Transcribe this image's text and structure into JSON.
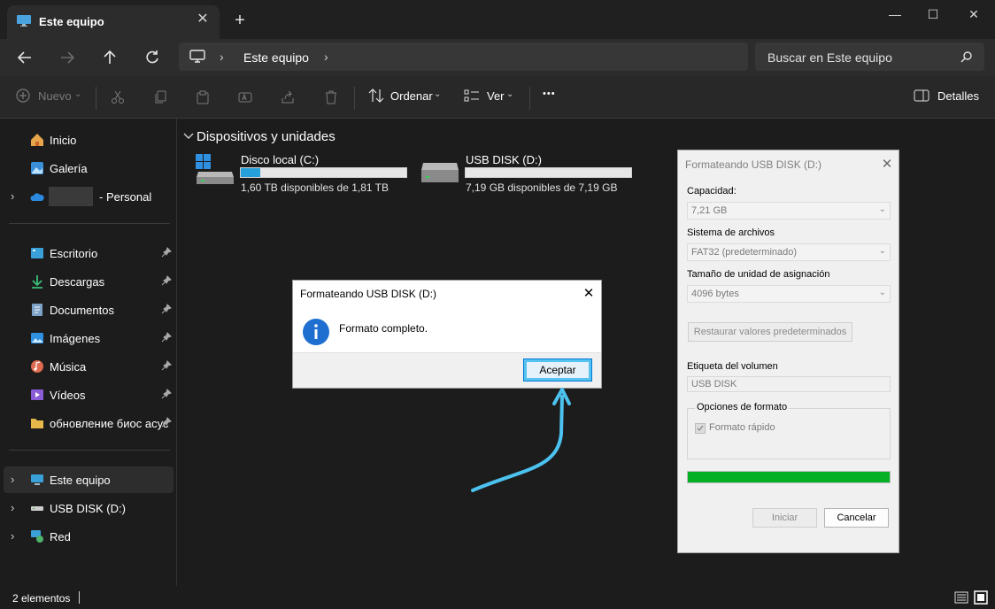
{
  "window": {
    "tab_title": "Este equipo",
    "tab_close": "✕",
    "new_tab": "+",
    "minimize": "—",
    "maximize": "☐",
    "close": "✕"
  },
  "nav": {
    "breadcrumb_current": "Este equipo",
    "breadcrumb_separator": "›",
    "search_placeholder": "Buscar en Este equipo"
  },
  "toolbar": {
    "new_label": "Nuevo",
    "sort_label": "Ordenar",
    "view_label": "Ver",
    "more_label": "•••",
    "details_label": "Detalles"
  },
  "sidebar": {
    "items": [
      {
        "label": "Inicio"
      },
      {
        "label": "Galería"
      },
      {
        "label": "- Personal"
      },
      {
        "label": "Escritorio"
      },
      {
        "label": "Descargas"
      },
      {
        "label": "Documentos"
      },
      {
        "label": "Imágenes"
      },
      {
        "label": "Música"
      },
      {
        "label": "Vídeos"
      },
      {
        "label": "обновление биос асус"
      },
      {
        "label": "Este equipo"
      },
      {
        "label": "USB DISK (D:)"
      },
      {
        "label": "Red"
      }
    ]
  },
  "main": {
    "section_title": "Dispositivos y unidades",
    "drives": [
      {
        "name": "Disco local (C:)",
        "info": "1,60 TB disponibles de 1,81 TB",
        "used_fraction": 0.12
      },
      {
        "name": "USB DISK (D:)",
        "info": "7,19 GB disponibles de 7,19 GB",
        "used_fraction": 0.0
      }
    ]
  },
  "status": {
    "count": "2 elementos"
  },
  "format_dialog": {
    "title": "Formateando USB DISK (D:)",
    "close": "✕",
    "capacity_label": "Capacidad:",
    "capacity_value": "7,21 GB",
    "filesystem_label": "Sistema de archivos",
    "filesystem_value": "FAT32 (predeterminado)",
    "allocation_label": "Tamaño de unidad de asignación",
    "allocation_value": "4096 bytes",
    "restore_button": "Restaurar valores predeterminados",
    "volume_label": "Etiqueta del volumen",
    "volume_value": "USB DISK",
    "options_label": "Opciones de formato",
    "quick_format_label": "Formato rápido",
    "progress_fraction": 1.0,
    "start_button": "Iniciar",
    "cancel_button": "Cancelar"
  },
  "message_box": {
    "title": "Formateando USB DISK (D:)",
    "close": "✕",
    "message": "Formato completo.",
    "ok_button": "Aceptar"
  },
  "colors": {
    "accent": "#0078d7",
    "progress": "#06b025",
    "annotation_arrow": "#4cc2f0"
  }
}
